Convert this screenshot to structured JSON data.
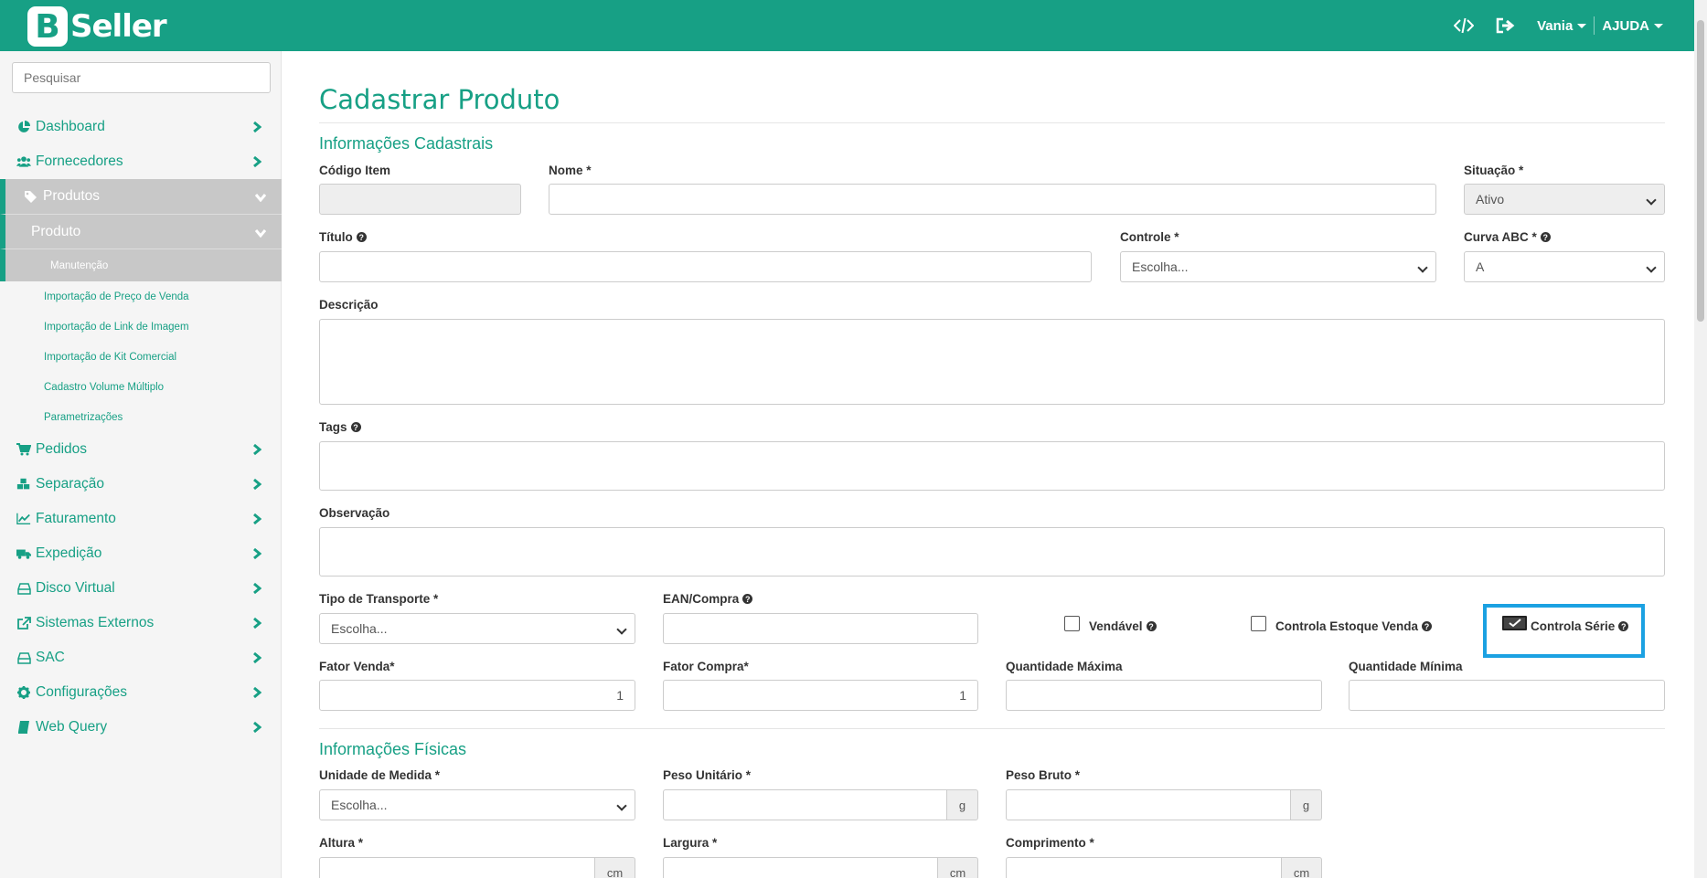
{
  "app": {
    "logo_letter": "B",
    "logo_text": "Seller"
  },
  "topbar": {
    "user": "Vania",
    "help": "AJUDA",
    "code_icon": "code-icon",
    "logout_icon": "sign-out-icon"
  },
  "sidebar": {
    "search_placeholder": "Pesquisar",
    "items": [
      {
        "label": "Dashboard",
        "icon": "pie-chart-icon"
      },
      {
        "label": "Fornecedores",
        "icon": "users-icon"
      },
      {
        "label": "Produtos",
        "icon": "tags-icon"
      },
      {
        "label": "Produto"
      },
      {
        "label": "Pedidos",
        "icon": "cart-icon"
      },
      {
        "label": "Separação",
        "icon": "cubes-icon"
      },
      {
        "label": "Faturamento",
        "icon": "line-chart-icon"
      },
      {
        "label": "Expedição",
        "icon": "truck-icon"
      },
      {
        "label": "Disco Virtual",
        "icon": "hdd-icon"
      },
      {
        "label": "Sistemas Externos",
        "icon": "external-link-icon"
      },
      {
        "label": "SAC",
        "icon": "hdd-icon"
      },
      {
        "label": "Configurações",
        "icon": "gear-icon"
      },
      {
        "label": "Web Query",
        "icon": "book-icon"
      }
    ],
    "sub_items": [
      "Manutenção",
      "Importação de Preço de Venda",
      "Importação de Link de Imagem",
      "Importação de Kit Comercial",
      "Cadastro Volume Múltiplo",
      "Parametrizações"
    ]
  },
  "page": {
    "title": "Cadastrar Produto",
    "section1": "Informações Cadastrais",
    "section2": "Informações Físicas"
  },
  "form": {
    "codigo_item": {
      "label": "Código Item",
      "value": ""
    },
    "nome": {
      "label": "Nome *",
      "value": ""
    },
    "situacao": {
      "label": "Situação *",
      "value": "Ativo"
    },
    "titulo": {
      "label": "Título",
      "value": ""
    },
    "controle": {
      "label": "Controle *",
      "value": "Escolha..."
    },
    "curva_abc": {
      "label": "Curva ABC *",
      "value": "A"
    },
    "descricao": {
      "label": "Descrição"
    },
    "tags": {
      "label": "Tags"
    },
    "observacao": {
      "label": "Observação"
    },
    "tipo_transporte": {
      "label": "Tipo de Transporte *",
      "value": "Escolha..."
    },
    "ean_compra": {
      "label": "EAN/Compra",
      "value": ""
    },
    "vendavel": {
      "label": "Vendável",
      "checked": false
    },
    "controla_estoque_venda": {
      "label": "Controla Estoque Venda",
      "checked": false
    },
    "controla_serie": {
      "label": "Controla Série",
      "checked": true
    },
    "fator_venda": {
      "label": "Fator Venda*",
      "value": "1"
    },
    "fator_compra": {
      "label": "Fator Compra*",
      "value": "1"
    },
    "quantidade_maxima": {
      "label": "Quantidade Máxima",
      "value": ""
    },
    "quantidade_minima": {
      "label": "Quantidade Mínima",
      "value": ""
    },
    "unidade_medida": {
      "label": "Unidade de Medida *",
      "value": "Escolha..."
    },
    "peso_unitario": {
      "label": "Peso Unitário *",
      "unit": "g"
    },
    "peso_bruto": {
      "label": "Peso Bruto *",
      "unit": "g"
    },
    "altura": {
      "label": "Altura *",
      "unit": "cm"
    },
    "largura": {
      "label": "Largura *",
      "unit": "cm"
    },
    "comprimento": {
      "label": "Comprimento *",
      "unit": "cm"
    }
  },
  "colors": {
    "brand": "#17a085",
    "highlight": "#1ba1e2"
  }
}
